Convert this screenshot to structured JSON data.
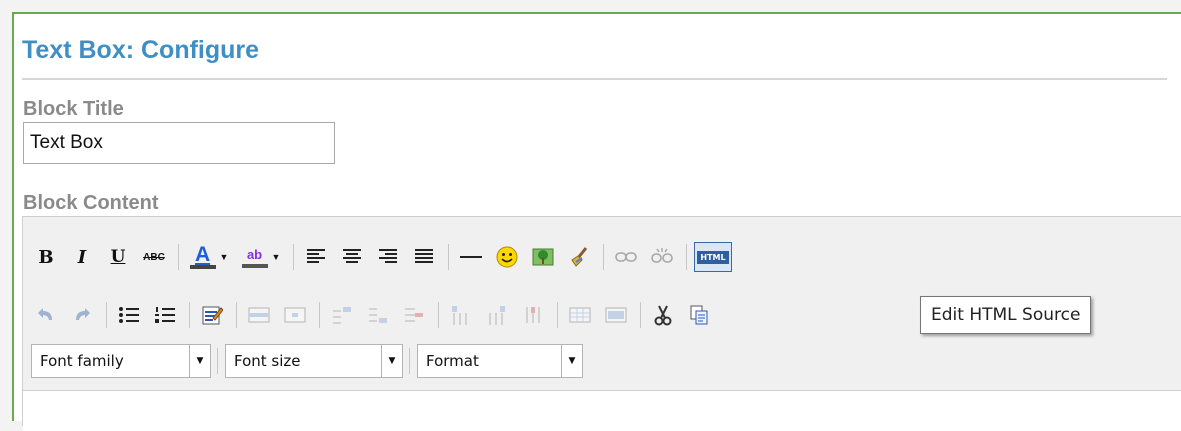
{
  "page": {
    "title": "Text Box: Configure",
    "block_title_label": "Block Title",
    "block_title_value": "Text Box",
    "block_content_label": "Block Content"
  },
  "toolbar": {
    "row1": [
      "bold",
      "italic",
      "underline",
      "strikethrough",
      "text-color",
      "highlight-color",
      "align-left",
      "align-center",
      "align-right",
      "align-justify",
      "horizontal-rule",
      "emoticon",
      "insert-image",
      "cleanup",
      "link",
      "unlink",
      "edit-html"
    ],
    "row2": [
      "undo",
      "redo",
      "bullet-list",
      "numbered-list",
      "paste-from-word",
      "table-row-props",
      "table-cell-props",
      "insert-row-before",
      "insert-row-after",
      "delete-row",
      "insert-column-before",
      "insert-column-after",
      "delete-column",
      "table",
      "merge-cells",
      "cut",
      "copy"
    ],
    "bold_label": "B",
    "italic_label": "I",
    "underline_label": "U",
    "strikethrough_label": "ABC",
    "text_color_label": "A",
    "highlight_label": "ab",
    "html_label": "HTML"
  },
  "selects": {
    "font_family": "Font family",
    "font_size": "Font size",
    "format": "Format"
  },
  "tooltip": {
    "text": "Edit HTML Source"
  },
  "colors": {
    "title": "#3f8fc5",
    "label": "#8a8a8a",
    "frame_border": "#6aa84f",
    "text_color_bar": "#1f5fcf",
    "highlight_bar": "#f4e000"
  }
}
